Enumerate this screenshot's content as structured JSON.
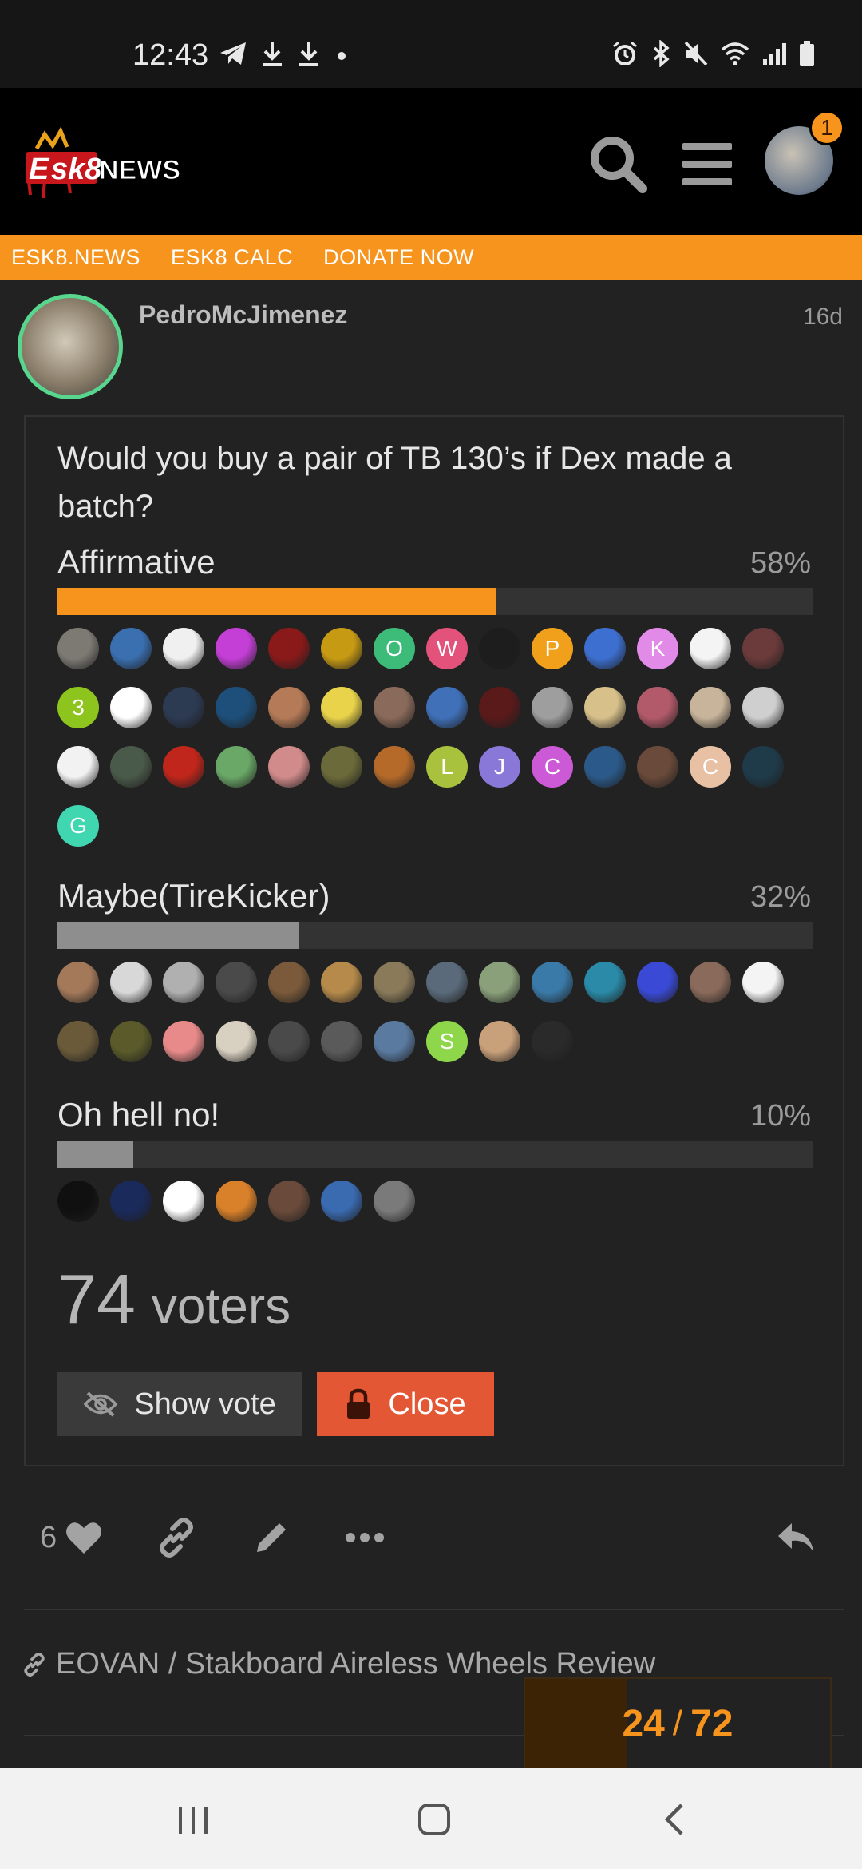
{
  "status": {
    "time": "12:43"
  },
  "header": {
    "logo_text": "ESK8NEWS",
    "notification_count": "1"
  },
  "nav_links": [
    "ESK8.NEWS",
    "ESK8 CALC",
    "DONATE NOW"
  ],
  "post": {
    "username": "PedroMcJimenez",
    "date": "16d"
  },
  "poll": {
    "question": "Would you buy a pair of TB 130’s if Dex made a batch?",
    "options": [
      {
        "label": "Affirmative",
        "percent": "58%",
        "fraction": 0.58,
        "bar_color": "#f7941d",
        "voters": [
          {
            "c": "#7d7a74"
          },
          {
            "c": "#3a6fb0"
          },
          {
            "c": "#f0f0f0"
          },
          {
            "c": "#c33fd6"
          },
          {
            "c": "#8a1a1a"
          },
          {
            "c": "#c79a14"
          },
          {
            "c": "#3dbb78",
            "l": "O"
          },
          {
            "c": "#e2527a",
            "l": "W"
          },
          {
            "c": "#1d1d1d"
          },
          {
            "c": "#f0a01a",
            "l": "P"
          },
          {
            "c": "#3d6fd0"
          },
          {
            "c": "#e18ae8",
            "l": "K"
          },
          {
            "c": "#f4f4f4"
          },
          {
            "c": "#6b3a3a"
          },
          {
            "c": "#8ec41e",
            "l": "3"
          },
          {
            "c": "#ffffff"
          },
          {
            "c": "#2c3a52"
          },
          {
            "c": "#1d4f7a"
          },
          {
            "c": "#b57a57"
          },
          {
            "c": "#e9d34a"
          },
          {
            "c": "#8a6a5a"
          },
          {
            "c": "#3f70b8"
          },
          {
            "c": "#5a1a1a"
          },
          {
            "c": "#9e9e9e"
          },
          {
            "c": "#d7c08a"
          },
          {
            "c": "#b35a6a"
          },
          {
            "c": "#c8b49a"
          },
          {
            "c": "#cfcfcf"
          },
          {
            "c": "#f2f2f2"
          },
          {
            "c": "#4a5a4a"
          },
          {
            "c": "#c0261b"
          },
          {
            "c": "#6aa867"
          },
          {
            "c": "#d28b8b"
          },
          {
            "c": "#6b6a3a"
          },
          {
            "c": "#b56a2a"
          },
          {
            "c": "#a8c23d",
            "l": "L"
          },
          {
            "c": "#8a78d8",
            "l": "J"
          },
          {
            "c": "#cc5ad6",
            "l": "C"
          },
          {
            "c": "#2b5a8a"
          },
          {
            "c": "#6a4a3a"
          },
          {
            "c": "#e8c1a4",
            "l": "C"
          },
          {
            "c": "#1f3b4a"
          },
          {
            "c": "#3fd6b0",
            "l": "G"
          }
        ]
      },
      {
        "label": "Maybe(TireKicker)",
        "percent": "32%",
        "fraction": 0.32,
        "bar_color": "#8e8e8e",
        "voters": [
          {
            "c": "#a4795a"
          },
          {
            "c": "#d8d8d8"
          },
          {
            "c": "#b0b0b0"
          },
          {
            "c": "#4a4a4a"
          },
          {
            "c": "#7a5a3a"
          },
          {
            "c": "#b58a4a"
          },
          {
            "c": "#8a7a5a"
          },
          {
            "c": "#5a6a7a"
          },
          {
            "c": "#8aa07a"
          },
          {
            "c": "#3a7aa8"
          },
          {
            "c": "#2a8aa8"
          },
          {
            "c": "#3a4ad6"
          },
          {
            "c": "#8a6a5a"
          },
          {
            "c": "#f4f4f4"
          },
          {
            "c": "#6a5a3a"
          },
          {
            "c": "#5a5a2a"
          },
          {
            "c": "#e88a8a"
          },
          {
            "c": "#d8d0c0"
          },
          {
            "c": "#4a4a4a"
          },
          {
            "c": "#5a5a5a"
          },
          {
            "c": "#5a7aa0"
          },
          {
            "c": "#8ed64a",
            "l": "S"
          },
          {
            "c": "#c8a07a"
          },
          {
            "c": "#2a2a2a"
          }
        ]
      },
      {
        "label": "Oh hell no!",
        "percent": "10%",
        "fraction": 0.1,
        "bar_color": "#8e8e8e",
        "voters": [
          {
            "c": "#101010"
          },
          {
            "c": "#1a2a5a"
          },
          {
            "c": "#ffffff"
          },
          {
            "c": "#d8802a"
          },
          {
            "c": "#6a4a3a"
          },
          {
            "c": "#3a6ab0"
          },
          {
            "c": "#7a7a7a"
          }
        ]
      }
    ],
    "voters_count": "74",
    "voters_word": "voters",
    "show_vote_label": "Show vote",
    "close_label": "Close"
  },
  "actions": {
    "like_count": "6"
  },
  "linked_topic": "EOVAN / Stakboard Aireless Wheels Review",
  "progress": {
    "current": "24",
    "total": "72",
    "fraction": 0.333
  }
}
